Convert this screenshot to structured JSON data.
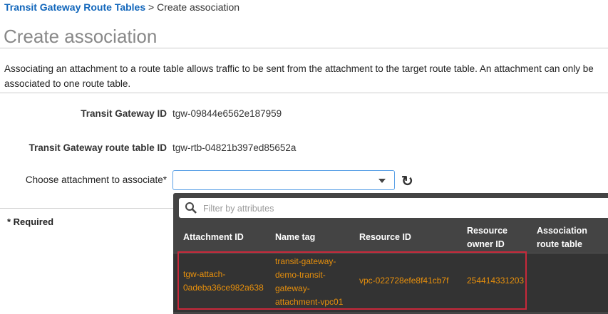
{
  "breadcrumb": {
    "parent": "Transit Gateway Route Tables",
    "separator": ">",
    "current": "Create association"
  },
  "page_title": "Create association",
  "description": "Associating an attachment to a route table allows traffic to be sent from the attachment to the target route table. An attachment can only be associated to one route table.",
  "fields": {
    "tgw_id_label": "Transit Gateway ID",
    "tgw_id_value": "tgw-09844e6562e187959",
    "rtb_label": "Transit Gateway route table ID",
    "rtb_value": "tgw-rtb-04821b397ed85652a",
    "attach_label": "Choose attachment to associate*"
  },
  "required_note": "* Required",
  "dropdown": {
    "filter_placeholder": "Filter by attributes",
    "columns": [
      "Attachment ID",
      "Name tag",
      "Resource ID",
      "Resource owner ID",
      "Association route table"
    ],
    "rows": [
      {
        "attachment_id": "tgw-attach-0adeba36ce982a638",
        "name_tag": "transit-gateway-demo-transit-gateway-attachment-vpc01",
        "resource_id": "vpc-022728efe8f41cb7f",
        "owner_id": "254414331203",
        "assoc_table": ""
      }
    ]
  },
  "icons": {
    "refresh": "refresh-icon",
    "search": "search-icon",
    "caret": "chevron-down-icon"
  },
  "colors": {
    "link": "#1166bb",
    "highlight": "#c8283a",
    "row_text": "#e8900c"
  }
}
